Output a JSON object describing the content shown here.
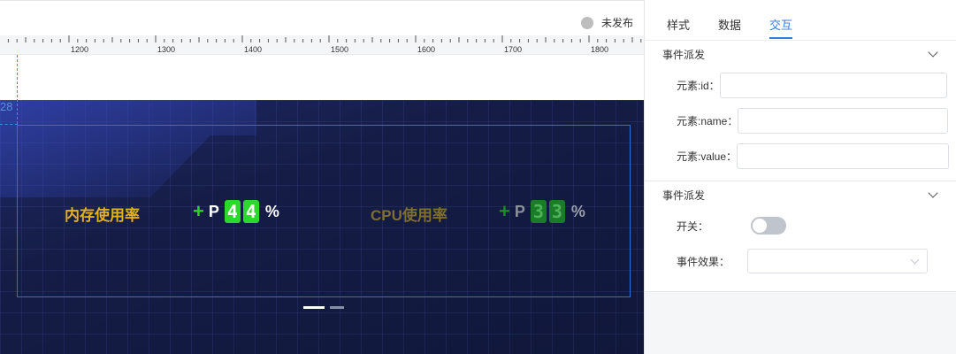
{
  "status": {
    "label": "未发布"
  },
  "ruler": {
    "ticks": [
      "1200",
      "1300",
      "1400",
      "1500",
      "1600",
      "1700",
      "1800"
    ]
  },
  "guide": {
    "value": "28"
  },
  "screen": {
    "memory": {
      "label": "内存使用率",
      "sign": "+",
      "prefix": "P",
      "digits": [
        "4",
        "4"
      ],
      "unit": "%"
    },
    "cpu": {
      "label": "CPU使用率",
      "sign": "+",
      "prefix": "P",
      "digits": [
        "3",
        "3"
      ],
      "unit": "%"
    },
    "pager": {
      "active_index": 0,
      "count": 2
    }
  },
  "panel": {
    "tabs": [
      {
        "label": "样式"
      },
      {
        "label": "数据"
      },
      {
        "label": "交互"
      }
    ],
    "active_tab": 2,
    "section1": {
      "title": "事件派发",
      "fields": [
        {
          "label": "元素:id：",
          "value": ""
        },
        {
          "label": "元素:name：",
          "value": ""
        },
        {
          "label": "元素:value：",
          "value": ""
        }
      ]
    },
    "section2": {
      "title": "事件派发",
      "switch_label": "开关：",
      "switch_on": false,
      "effect_label": "事件效果：",
      "effect_value": ""
    }
  },
  "colors": {
    "accent": "#2f7de1",
    "memory_label": "#e3b21b",
    "digit_active": "#2bd92b",
    "frame": "#2f6fd6"
  }
}
